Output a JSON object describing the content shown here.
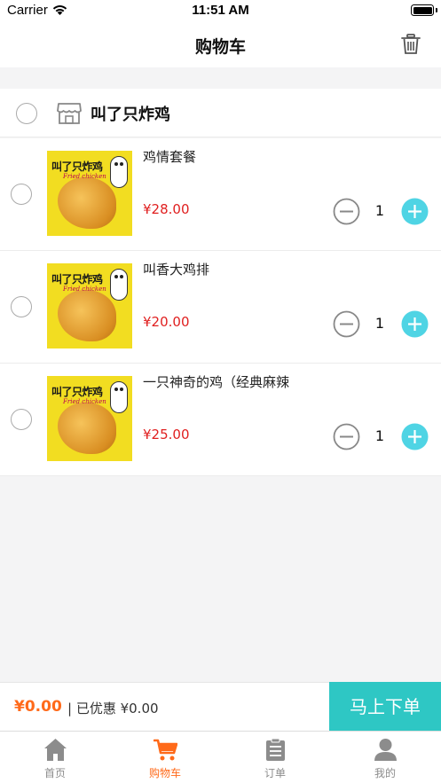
{
  "status_bar": {
    "carrier": "Carrier",
    "time": "11:51 AM"
  },
  "nav": {
    "title": "购物车",
    "trash_icon": "trash-icon"
  },
  "shop": {
    "name": "叫了只炸鸡",
    "icon": "store-icon"
  },
  "thumbnail": {
    "title": "叫了只炸鸡",
    "subtitle": "Fried chicken"
  },
  "items": [
    {
      "name": "鸡情套餐",
      "price": "¥28.00",
      "quantity": "1"
    },
    {
      "name": "叫香大鸡排",
      "price": "¥20.00",
      "quantity": "1"
    },
    {
      "name": "一只神奇的鸡（经典麻辣",
      "price": "¥25.00",
      "quantity": "1"
    }
  ],
  "checkout": {
    "total": "¥0.00",
    "discount": "| 已优惠 ¥0.00",
    "order_button": "马上下单"
  },
  "tabs": [
    {
      "label": "首页",
      "icon": "home-icon",
      "active": false
    },
    {
      "label": "购物车",
      "icon": "cart-icon",
      "active": true
    },
    {
      "label": "订单",
      "icon": "clipboard-icon",
      "active": false
    },
    {
      "label": "我的",
      "icon": "user-icon",
      "active": false
    }
  ],
  "colors": {
    "accent": "#ff6a1a",
    "price": "#e02020",
    "order_button": "#2ec7c4",
    "plus": "#4fd4e4",
    "tab_inactive": "#8c8c8c"
  }
}
